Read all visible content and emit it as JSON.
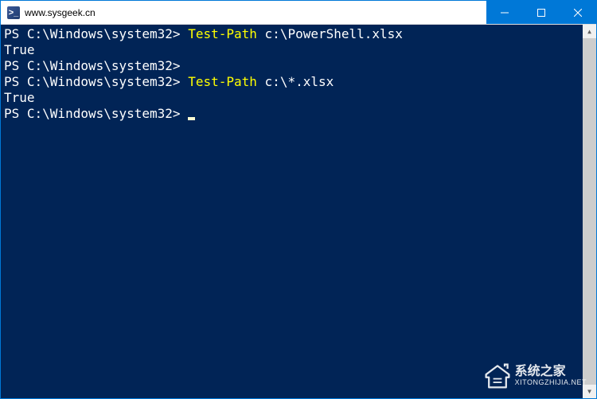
{
  "window": {
    "title": "www.sysgeek.cn",
    "icon_glyph": ">_"
  },
  "terminal": {
    "lines": [
      {
        "prompt": "PS C:\\Windows\\system32>",
        "cmd": "Test-Path",
        "arg": "c:\\PowerShell.xlsx"
      },
      {
        "output": "True"
      },
      {
        "prompt": "PS C:\\Windows\\system32>",
        "cmd": "",
        "arg": ""
      },
      {
        "prompt": "PS C:\\Windows\\system32>",
        "cmd": "Test-Path",
        "arg": "c:\\*.xlsx"
      },
      {
        "output": "True"
      },
      {
        "prompt": "PS C:\\Windows\\system32>",
        "cmd": "",
        "arg": "",
        "cursor": true
      }
    ]
  },
  "watermark": {
    "title": "系统之家",
    "url": "XITONGZHIJIA.NET"
  },
  "colors": {
    "terminal_bg": "#012456",
    "prompt": "#ffffff",
    "command": "#ffff00",
    "titlebar_btn": "#0078d7"
  }
}
